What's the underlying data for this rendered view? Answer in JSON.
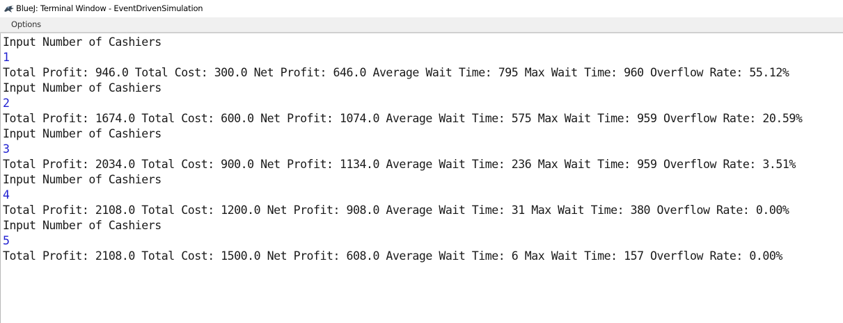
{
  "window": {
    "title": "BlueJ: Terminal Window - EventDrivenSimulation"
  },
  "menu": {
    "options_label": "Options"
  },
  "terminal": {
    "lines": [
      {
        "text": "Input Number of Cashiers",
        "kind": "output"
      },
      {
        "text": "1",
        "kind": "input"
      },
      {
        "text": "Total Profit: 946.0 Total Cost: 300.0 Net Profit: 646.0 Average Wait Time: 795 Max Wait Time: 960 Overflow Rate: 55.12%",
        "kind": "output"
      },
      {
        "text": "Input Number of Cashiers",
        "kind": "output"
      },
      {
        "text": "2",
        "kind": "input"
      },
      {
        "text": "Total Profit: 1674.0 Total Cost: 600.0 Net Profit: 1074.0 Average Wait Time: 575 Max Wait Time: 959 Overflow Rate: 20.59%",
        "kind": "output"
      },
      {
        "text": "Input Number of Cashiers",
        "kind": "output"
      },
      {
        "text": "3",
        "kind": "input"
      },
      {
        "text": "Total Profit: 2034.0 Total Cost: 900.0 Net Profit: 1134.0 Average Wait Time: 236 Max Wait Time: 959 Overflow Rate: 3.51%",
        "kind": "output"
      },
      {
        "text": "Input Number of Cashiers",
        "kind": "output"
      },
      {
        "text": "4",
        "kind": "input"
      },
      {
        "text": "Total Profit: 2108.0 Total Cost: 1200.0 Net Profit: 908.0 Average Wait Time: 31 Max Wait Time: 380 Overflow Rate: 0.00%",
        "kind": "output"
      },
      {
        "text": "Input Number of Cashiers",
        "kind": "output"
      },
      {
        "text": "5",
        "kind": "input"
      },
      {
        "text": "Total Profit: 2108.0 Total Cost: 1500.0 Net Profit: 608.0 Average Wait Time: 6 Max Wait Time: 157 Overflow Rate: 0.00%",
        "kind": "output"
      }
    ]
  },
  "colors": {
    "output_text": "#1a1a1a",
    "input_text": "#1f1fd0",
    "background": "#ffffff",
    "menubar": "#f0f0f0"
  },
  "icons": {
    "app": "bluej-bird-icon"
  }
}
